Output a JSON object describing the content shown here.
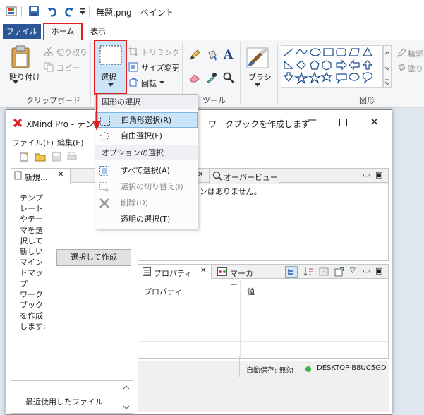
{
  "paint": {
    "title": "無題.png - ペイント",
    "tabs": {
      "file": "ファイル",
      "home": "ホーム",
      "view": "表示"
    },
    "clipboard": {
      "paste": "貼り付け",
      "cut": "切り取り",
      "copy": "コピー",
      "group": "クリップボード"
    },
    "image": {
      "select": "選択",
      "crop": "トリミング",
      "resize": "サイズ変更",
      "rotate": "回転"
    },
    "tools": {
      "group": "ツール"
    },
    "brush": {
      "label": "ブラシ"
    },
    "shapes": {
      "group": "図形",
      "outline": "輪郭",
      "fill": "塗り"
    }
  },
  "dropdown": {
    "section1": "図形の選択",
    "rect_select": "四角形選択(R)",
    "free_select": "自由選択(F)",
    "section2": "オプションの選択",
    "select_all": "すべて選択(A)",
    "invert": "選択の切り替え(I)",
    "delete": "削除(D)",
    "transparent": "透明の選択(T)"
  },
  "xmind": {
    "title": "XMind Pro - テンプ",
    "title_suffix": "ワークブックを作成します",
    "menu": {
      "file": "ファイル(F)",
      "edit": "編集(E)"
    },
    "left_pane_tab": "新規...",
    "description": [
      "テンプ",
      "レート",
      "やテー",
      "マを選",
      "択して",
      "新しい",
      "マイン",
      "ドマップ",
      "ワーク",
      "ブック",
      "を作成",
      "します:"
    ],
    "create_button": "選択して作成",
    "recent_label": "最近使用したファイル",
    "overview_tab": "オーバービュー",
    "overview_message": "インはありません。",
    "properties_tab": "プロパティ",
    "markers_tab": "マーカー",
    "prop_col1": "プロパティ",
    "prop_col2": "値",
    "autosave": "自動保存: 無効",
    "host": "DESKTOP-B8UC5GD"
  },
  "colors": {
    "accent_red": "#e31e1e",
    "file_tab": "#2b5797",
    "hover_blue": "#cce4f7"
  }
}
